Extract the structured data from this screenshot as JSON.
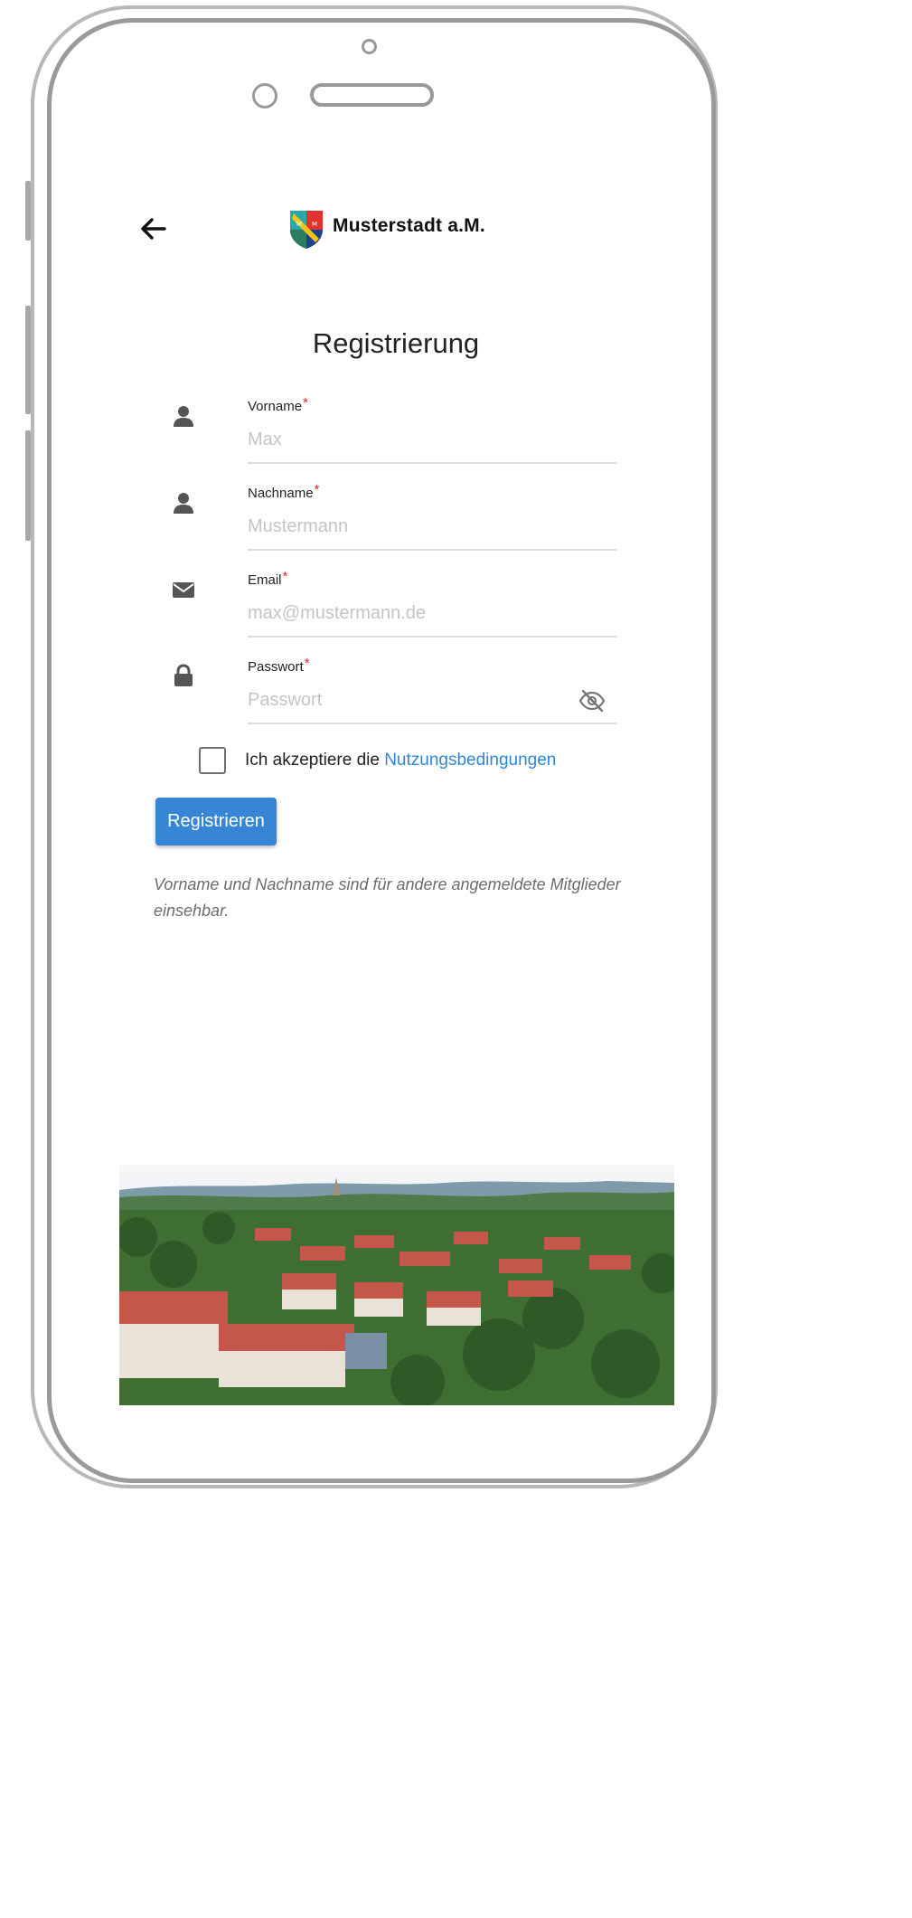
{
  "header": {
    "brand_name": "Musterstadt a.M."
  },
  "page": {
    "title": "Registrierung"
  },
  "form": {
    "fields": [
      {
        "label": "Vorname",
        "required_mark": "*",
        "placeholder": "Max",
        "icon": "user-icon"
      },
      {
        "label": "Nachname",
        "required_mark": "*",
        "placeholder": "Mustermann",
        "icon": "user-icon"
      },
      {
        "label": "Email",
        "required_mark": "*",
        "placeholder": "max@mustermann.de",
        "icon": "envelope-icon"
      },
      {
        "label": "Passwort",
        "required_mark": "*",
        "placeholder": "Passwort",
        "icon": "lock-icon",
        "toggle_icon": "eye-slash-icon"
      }
    ],
    "terms": {
      "prefix": "Ich akzeptiere die",
      "link": "Nutzungsbedingungen",
      "checked": false
    },
    "submit_label": "Registrieren",
    "note": "Vorname und Nachname sind für andere angemeldete Mitglieder einsehbar."
  },
  "colors": {
    "accent": "#3786d6",
    "link": "#2f86d8",
    "required": "#d9262c",
    "placeholder": "#c4c4c4"
  }
}
